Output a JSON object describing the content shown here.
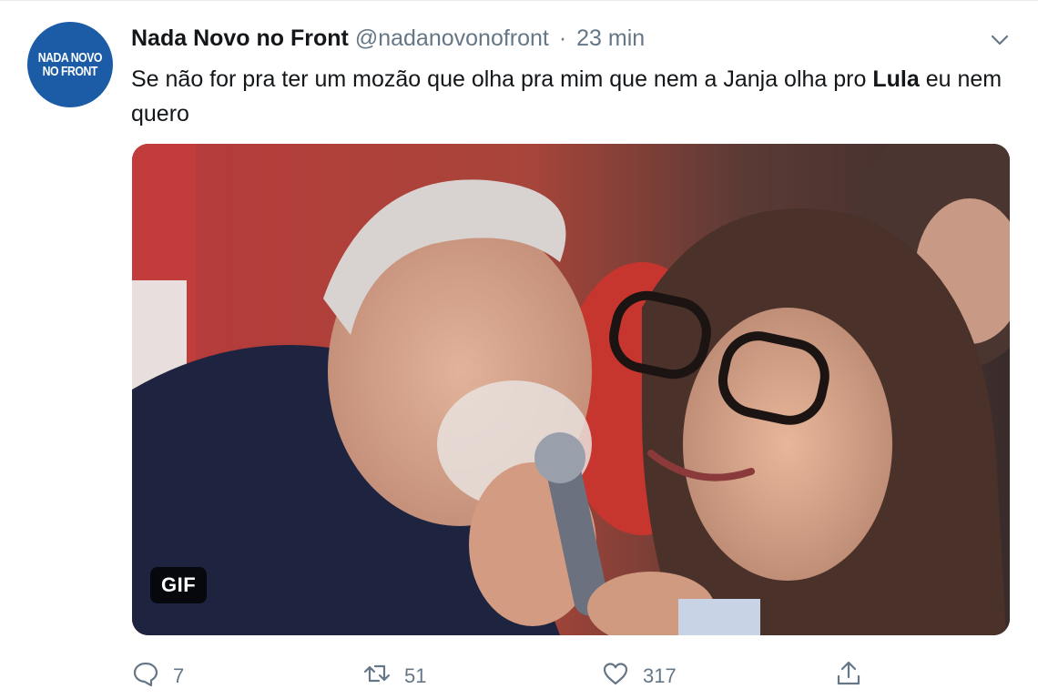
{
  "tweet": {
    "avatar": {
      "line1": "NADA NOVO",
      "line2": "NO FRONT",
      "bg_color": "#1c5ba6"
    },
    "display_name": "Nada Novo no Front",
    "handle": "@nadanovonofront",
    "separator": "·",
    "time": "23 min",
    "menu_icon": "chevron-down-icon",
    "text_part1": "Se não for pra ter um mozão que olha pra mim que nem a Janja olha pro ",
    "text_highlight": "Lula",
    "text_part2": " eu nem quero",
    "media": {
      "badge": "GIF"
    },
    "actions": {
      "reply": {
        "icon": "reply-icon",
        "count": "7"
      },
      "retweet": {
        "icon": "retweet-icon",
        "count": "51"
      },
      "like": {
        "icon": "heart-icon",
        "count": "317"
      },
      "share": {
        "icon": "share-icon"
      }
    }
  }
}
